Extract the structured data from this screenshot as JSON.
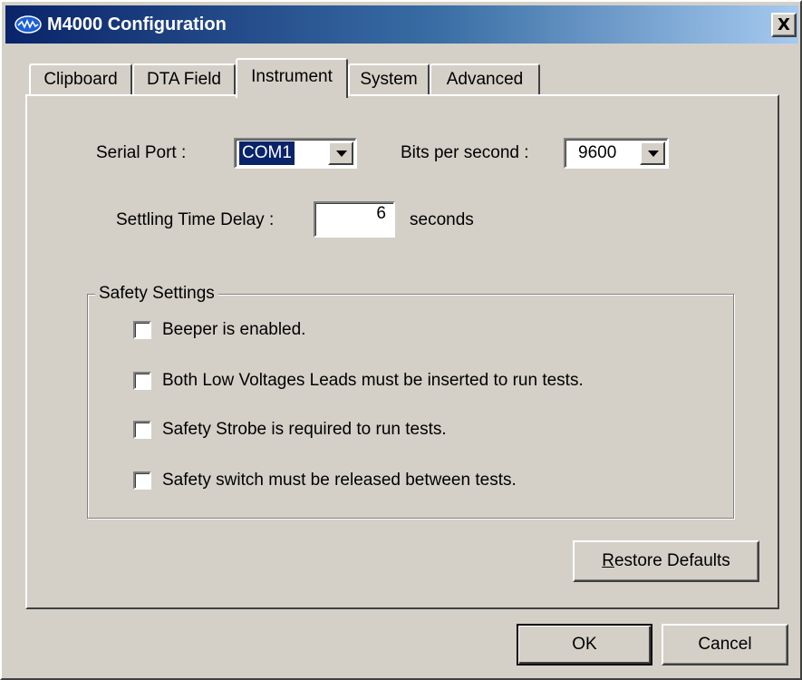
{
  "window": {
    "title": "M4000 Configuration",
    "close_glyph": "X"
  },
  "tabs": [
    {
      "label": "Clipboard",
      "active": false
    },
    {
      "label": "DTA Field",
      "active": false
    },
    {
      "label": "Instrument",
      "active": true
    },
    {
      "label": "System",
      "active": false
    },
    {
      "label": "Advanced",
      "active": false
    }
  ],
  "instrument": {
    "serial_port_label": "Serial Port :",
    "serial_port_value": "COM1",
    "bits_per_second_label": "Bits per second :",
    "bits_per_second_value": "9600",
    "settling_time_label": "Settling Time Delay :",
    "settling_time_value": "6",
    "settling_time_unit": "seconds"
  },
  "safety": {
    "group_title": "Safety Settings",
    "options": [
      {
        "label": "Beeper is enabled.",
        "checked": false
      },
      {
        "label": "Both Low Voltages Leads must be inserted to run tests.",
        "checked": false
      },
      {
        "label": "Safety Strobe is required to run tests.",
        "checked": false
      },
      {
        "label": "Safety switch must be released between tests.",
        "checked": false
      }
    ]
  },
  "buttons": {
    "restore_defaults_mnemonic": "R",
    "restore_defaults_rest": "estore Defaults",
    "ok": "OK",
    "cancel": "Cancel"
  },
  "colors": {
    "title_bar_start": "#0a246a",
    "title_bar_end": "#a6caf0",
    "dialog_face": "#d4d0c8",
    "selection": "#0a246a"
  },
  "icons": {
    "app": "waveform-icon",
    "close": "close-icon",
    "dropdown": "chevron-down-icon"
  }
}
